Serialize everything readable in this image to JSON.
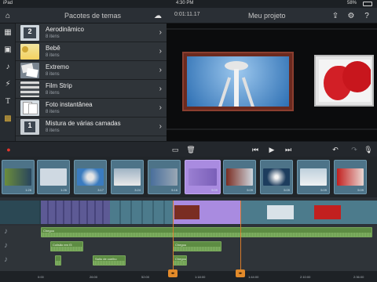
{
  "status": {
    "device": "iPad",
    "time": "4:30 PM",
    "battery": "58%"
  },
  "header": {
    "panel_title": "Pacotes de temas",
    "timecode": "0:01:11.17",
    "project_title": "Meu projeto"
  },
  "themes": {
    "items": [
      {
        "name": "Aerodinâmico",
        "count": "8 itens"
      },
      {
        "name": "Bebê",
        "count": "8 itens"
      },
      {
        "name": "Extremo",
        "count": "8 itens"
      },
      {
        "name": "Film Strip",
        "count": "8 itens"
      },
      {
        "name": "Foto instantânea",
        "count": "8 itens"
      },
      {
        "name": "Mistura de várias camadas",
        "count": "8 itens"
      }
    ]
  },
  "storyboard": {
    "clips": [
      {
        "duration": "1:26"
      },
      {
        "duration": "1:26"
      },
      {
        "duration": "3:17"
      },
      {
        "duration": "3:24"
      },
      {
        "duration": "5:16"
      },
      {
        "duration": "5:09"
      },
      {
        "duration": "5:09"
      },
      {
        "duration": "5:09"
      },
      {
        "duration": "5:09"
      },
      {
        "duration": "5:09"
      }
    ]
  },
  "audio": {
    "track1": "Chegou",
    "track2a": "Colisão em f3",
    "track2b": "Chegou",
    "track3a": "Salto de coelho",
    "track3b": "Chegou"
  },
  "ruler": {
    "ticks": [
      "0:00",
      "26:00",
      "52:00",
      "1:18:00",
      "1:44:00",
      "2:10:00",
      "2:36:00"
    ]
  },
  "colors": {
    "accent": "#a98be0",
    "audio": "#5d8c43",
    "playhead": "#d77a2a"
  }
}
